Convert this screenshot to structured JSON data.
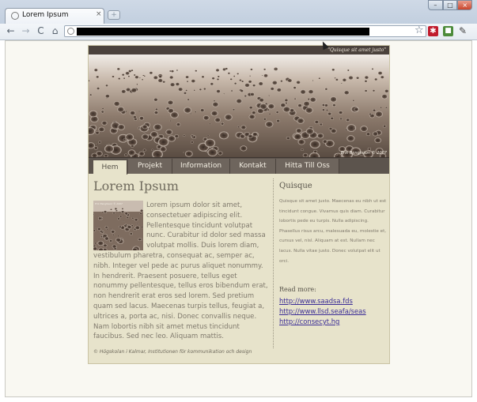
{
  "browser": {
    "tab_title": "Lorem Ipsum",
    "tab_close": "×",
    "new_tab": "+",
    "window_buttons": [
      "–",
      "□",
      "×"
    ],
    "nav": {
      "back": "←",
      "forward": "→",
      "reload": "C",
      "home": "⌂"
    },
    "url_redacted": true,
    "icons": [
      "star-icon",
      "extension-icon",
      "extension-icon",
      "wrench-icon"
    ]
  },
  "site": {
    "header_quote": "\"Quisque sit amet justo\"",
    "header_credit": "Erik Bengtsson © 2007",
    "nav": [
      "Hem",
      "Projekt",
      "Information",
      "Kontakt",
      "Hitta Till Oss"
    ],
    "active_nav": "Hem",
    "main": {
      "title": "Lorem Ipsum",
      "body": "Lorem ipsum dolor sit amet, consectetuer adipiscing elit. Pellentesque tincidunt volutpat nunc. Curabitur id dolor sed massa volutpat mollis. Duis lorem diam, vestibulum pharetra, consequat ac, semper ac, nibh. Integer vel pede ac purus aliquet nonummy. In hendrerit. Praesent posuere, tellus eget nonummy pellentesque, tellus eros bibendum erat, non hendrerit erat eros sed lorem. Sed pretium quam sed lacus. Maecenas turpis tellus, feugiat a, ultrices a, porta ac, nisi. Donec convallis neque. Nam lobortis nibh sit amet metus tincidunt faucibus. Sed nec leo. Aliquam mattis.",
      "thumb_credit": "Erik Bengtsson © 2007",
      "footer": "© Högskolan i Kalmar, Institutionen för kommunikation och design"
    },
    "sidebar": {
      "title": "Quisque",
      "text": "Quisque sit amet justo. Maecenas eu nibh ut est tincidunt congue. Vivamus quis diam. Curabitur lobortis pede eu turpis. Nulla adipiscing. Phasellus risus arcu, malesuada eu, molestie et, cursus vel, nisl. Aliquam at est. Nullam nec lacus. Nulla vitae justo. Donec volutpat elit ut orci.",
      "read_more": "Read more:",
      "links": [
        "http://www.saadsa.fds",
        "http://www.llsd.seafa/seas",
        "http://consecyt.hg"
      ]
    }
  }
}
